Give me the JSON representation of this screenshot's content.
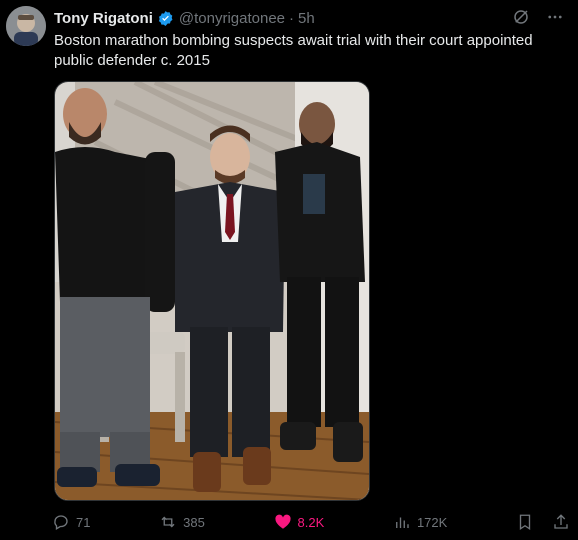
{
  "post": {
    "author_name": "Tony Rigatoni",
    "handle": "@tonyrigatonee",
    "separator": "·",
    "time": "5h",
    "text": "Boston marathon bombing suspects await trial with their court appointed public defender c. 2015"
  },
  "actions": {
    "replies": "71",
    "reposts": "385",
    "likes": "8.2K",
    "views": "172K"
  },
  "colors": {
    "background": "#000000",
    "text": "#e7e9ea",
    "muted": "#71767b",
    "verified": "#1d9bf0",
    "like": "#f91880"
  },
  "icons": [
    "verified-badge-icon",
    "grok-icon",
    "more-icon",
    "reply-icon",
    "repost-icon",
    "heart-icon",
    "views-icon",
    "bookmark-icon",
    "share-icon"
  ]
}
